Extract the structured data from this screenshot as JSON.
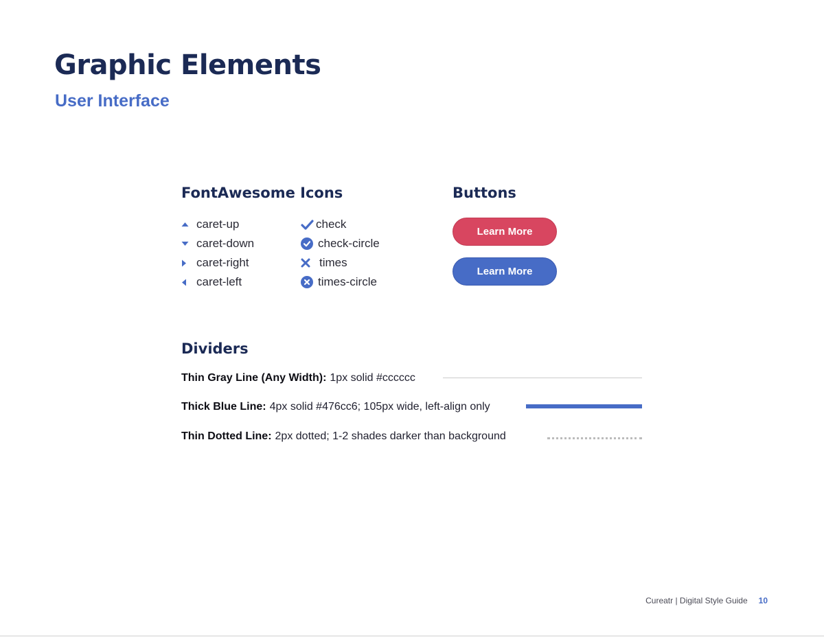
{
  "header": {
    "title": "Graphic Elements",
    "subtitle": "User Interface"
  },
  "icons_section": {
    "heading": "FontAwesome Icons",
    "left_column": [
      {
        "icon": "caret-up-icon",
        "label": "caret-up"
      },
      {
        "icon": "caret-down-icon",
        "label": "caret-down"
      },
      {
        "icon": "caret-right-icon",
        "label": "caret-right"
      },
      {
        "icon": "caret-left-icon",
        "label": "caret-left"
      }
    ],
    "right_column": [
      {
        "icon": "check-icon",
        "label": "check"
      },
      {
        "icon": "check-circle-icon",
        "label": "check-circle"
      },
      {
        "icon": "times-icon",
        "label": "times"
      },
      {
        "icon": "times-circle-icon",
        "label": "times-circle"
      }
    ],
    "icon_color": "#476cc6"
  },
  "buttons_section": {
    "heading": "Buttons",
    "buttons": [
      {
        "label": "Learn More",
        "color": "#d84660"
      },
      {
        "label": "Learn More",
        "color": "#476cc6"
      }
    ]
  },
  "dividers_section": {
    "heading": "Dividers",
    "items": [
      {
        "label": "Thin Gray Line (Any Width):",
        "description": "1px solid #cccccc"
      },
      {
        "label": "Thick Blue Line:",
        "description": "4px solid #476cc6; 105px wide, left-align only"
      },
      {
        "label": "Thin Dotted Line:",
        "description": "2px dotted; 1-2 shades darker than background"
      }
    ]
  },
  "footer": {
    "text": "Cureatr | Digital Style Guide",
    "page_number": "10"
  }
}
